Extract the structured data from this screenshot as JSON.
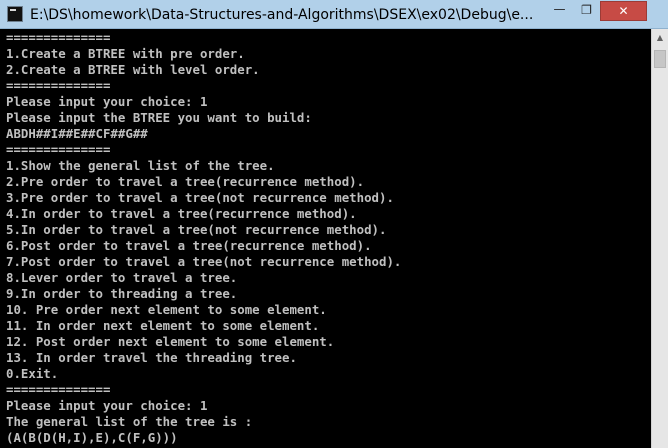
{
  "window": {
    "title": "E:\\DS\\homework\\Data-Structures-and-Algorithms\\DSEX\\ex02\\Debug\\e...",
    "minimize_glyph": "—",
    "maximize_glyph": "❐",
    "close_glyph": "✕"
  },
  "console": {
    "lines": [
      "==============",
      "1.Create a BTREE with pre order.",
      "2.Create a BTREE with level order.",
      "==============",
      "Please input your choice: 1",
      "Please input the BTREE you want to build:",
      "ABDH##I##E##CF##G##",
      "==============",
      "1.Show the general list of the tree.",
      "2.Pre order to travel a tree(recurrence method).",
      "3.Pre order to travel a tree(not recurrence method).",
      "4.In order to travel a tree(recurrence method).",
      "5.In order to travel a tree(not recurrence method).",
      "6.Post order to travel a tree(recurrence method).",
      "7.Post order to travel a tree(not recurrence method).",
      "8.Lever order to travel a tree.",
      "9.In order to threading a tree.",
      "10. Pre order next element to some element.",
      "11. In order next element to some element.",
      "12. Post order next element to some element.",
      "13. In order travel the threading tree.",
      "0.Exit.",
      "==============",
      "Please input your choice: 1",
      "The general list of the tree is :",
      "(A(B(D(H,I),E),C(F,G)))"
    ]
  },
  "scrollbar": {
    "up_arrow": "▲"
  },
  "colors": {
    "titlebar": "#b1d0e9",
    "console_bg": "#000000",
    "console_text": "#c0c0c0",
    "close_button": "#c74b45"
  }
}
